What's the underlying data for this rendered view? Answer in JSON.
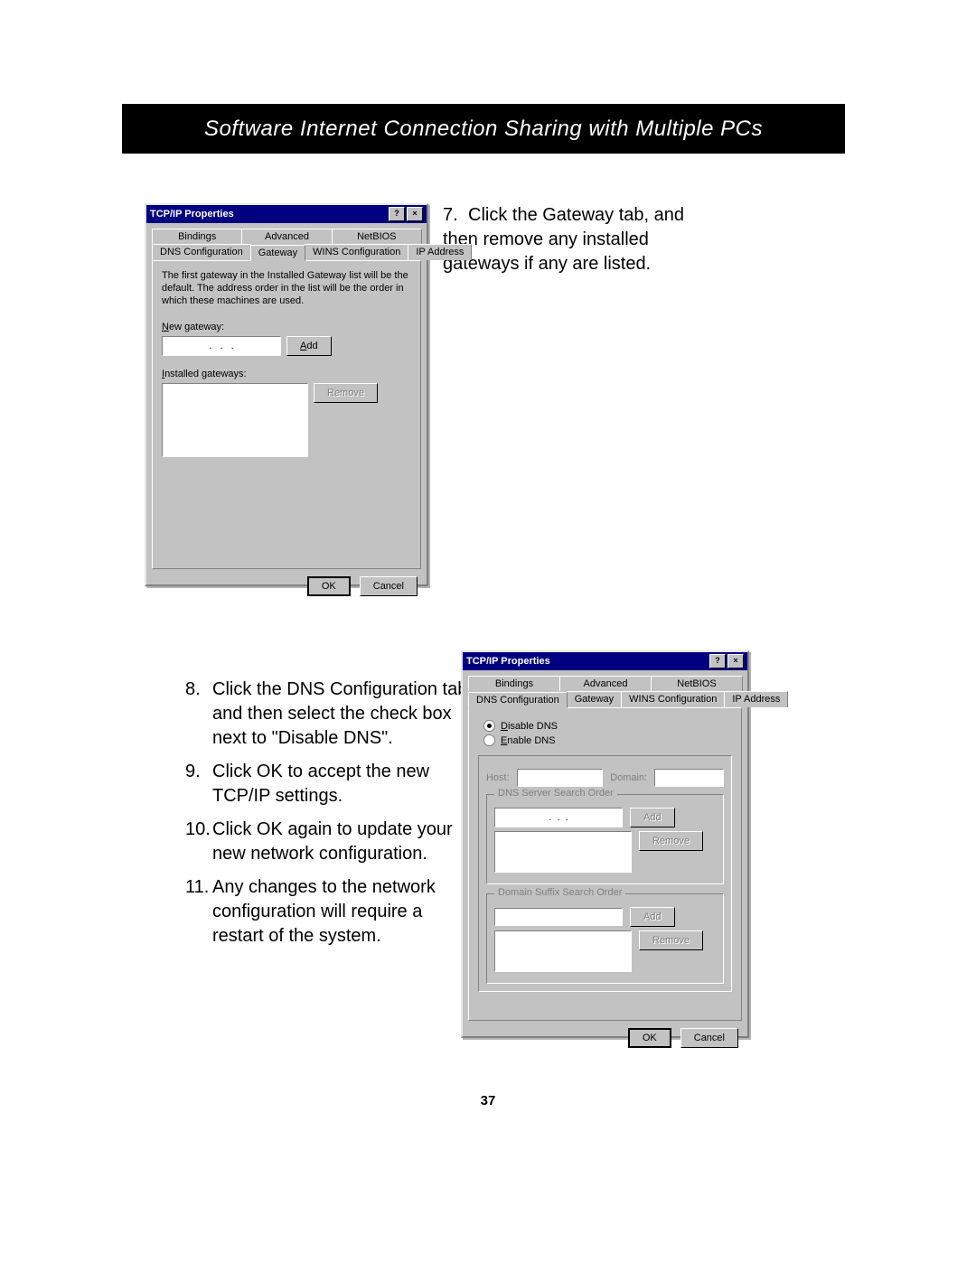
{
  "header": "Software Internet Connection Sharing with Multiple PCs",
  "pageNumber": "37",
  "step7": {
    "num": "7.",
    "text": "Click the Gateway tab, and then remove any installed gateways if any are listed."
  },
  "stepsLeft": [
    {
      "n": "8.",
      "text": "Click the DNS Configuration tab, and then select the check box next to \"Disable DNS\"."
    },
    {
      "n": "9.",
      "text": "Click OK to accept the new TCP/IP settings."
    },
    {
      "n": "10.",
      "text": "Click OK again to update your new network configuration."
    },
    {
      "n": "11.",
      "text": "Any changes to the network configuration will require a restart of the system."
    }
  ],
  "dialog": {
    "title": "TCP/IP Properties",
    "helpIcon": "?",
    "closeIcon": "×",
    "tabsRow1": [
      "Bindings",
      "Advanced",
      "NetBIOS"
    ],
    "tabsRow2": [
      "DNS Configuration",
      "Gateway",
      "WINS Configuration",
      "IP Address"
    ],
    "ok": "OK",
    "cancel": "Cancel"
  },
  "dlg1": {
    "activeTab": "Gateway",
    "info": "The first gateway in the Installed Gateway list will be the default. The address order in the list will be the order in which these machines are used.",
    "newGatewayLabel": "New gateway:",
    "addBtn": "Add",
    "installedLabel": "Installed gateways:",
    "removeBtn": "Remove"
  },
  "dlg2": {
    "activeTab": "DNS Configuration",
    "disableDNS": "Disable DNS",
    "enableDNS": "Enable DNS",
    "hostLabel": "Host:",
    "domainLabel": "Domain:",
    "dnsOrder": "DNS Server Search Order",
    "addBtn": "Add",
    "removeBtn": "Remove",
    "suffixOrder": "Domain Suffix Search Order"
  }
}
